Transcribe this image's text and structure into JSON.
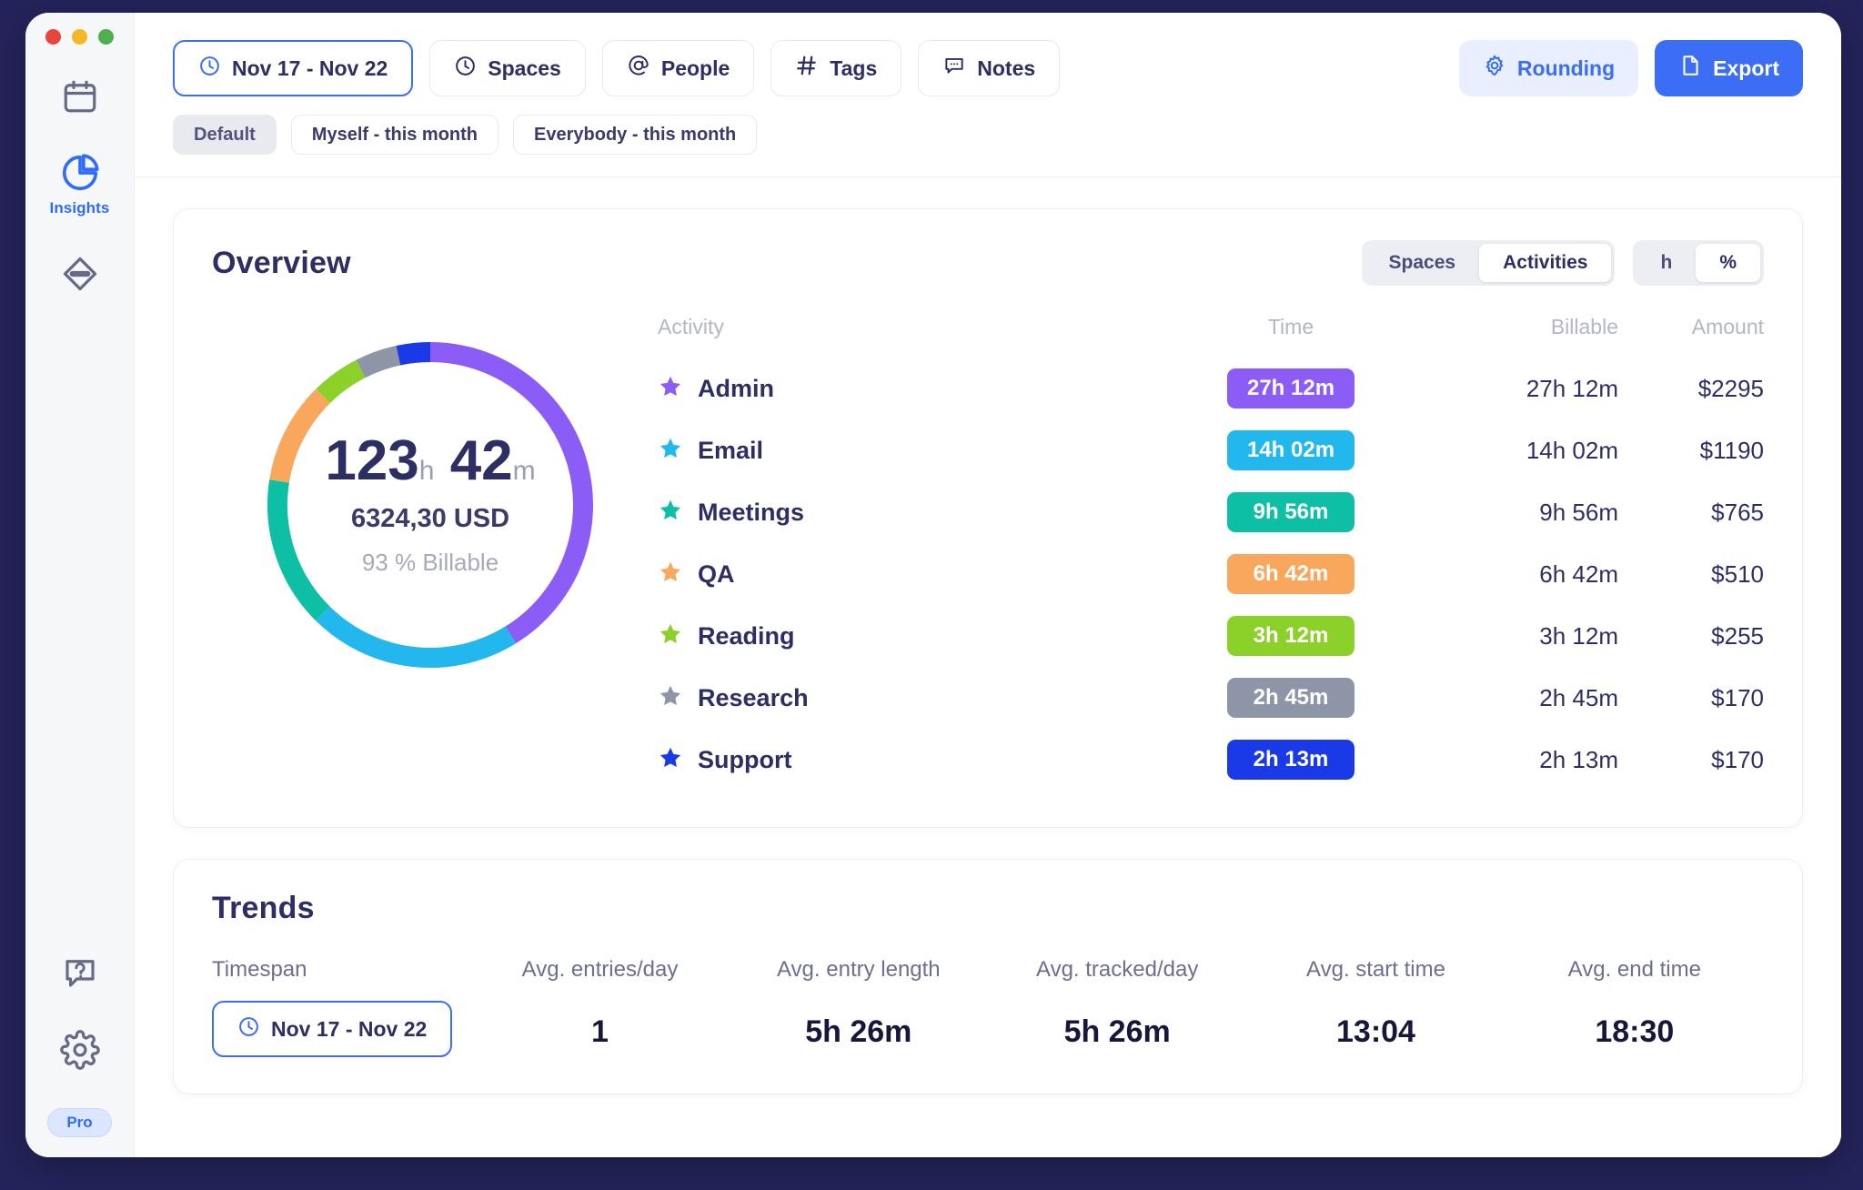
{
  "window": {
    "traffic_lights": [
      "close",
      "minimize",
      "maximize"
    ]
  },
  "sidebar": {
    "items": [
      {
        "icon": "calendar-icon",
        "label": ""
      },
      {
        "icon": "pie-chart-icon",
        "label": "Insights"
      },
      {
        "icon": "diamond-icon",
        "label": ""
      }
    ],
    "bottom_items": [
      {
        "icon": "help-icon",
        "label": ""
      },
      {
        "icon": "gear-icon",
        "label": ""
      }
    ],
    "pro_badge": "Pro",
    "active_color": "#2f6bff"
  },
  "toolbar": {
    "filters": [
      {
        "icon": "clock-icon",
        "label": "Nov 17 - Nov 22",
        "active": true
      },
      {
        "icon": "clock-icon",
        "label": "Spaces",
        "active": false
      },
      {
        "icon": "at-icon",
        "label": "People",
        "active": false
      },
      {
        "icon": "hash-icon",
        "label": "Tags",
        "active": false
      },
      {
        "icon": "comment-icon",
        "label": "Notes",
        "active": false
      }
    ],
    "rounding_label": "Rounding",
    "export_label": "Export",
    "accent": "#3b6df5"
  },
  "chips": [
    {
      "label": "Default",
      "selected": true
    },
    {
      "label": "Myself - this month",
      "selected": false
    },
    {
      "label": "Everybody - this month",
      "selected": false
    }
  ],
  "overview": {
    "title": "Overview",
    "toggle_group": [
      {
        "label": "Spaces",
        "on": false
      },
      {
        "label": "Activities",
        "on": true
      }
    ],
    "unit_group": [
      {
        "label": "h",
        "on": false
      },
      {
        "label": "%",
        "on": true
      }
    ],
    "center": {
      "hours": "123",
      "hours_unit": "h",
      "minutes": "42",
      "minutes_unit": "m",
      "amount": "6324,30 USD",
      "billable": "93 %  Billable"
    },
    "columns": [
      "Activity",
      "Time",
      "Billable",
      "Amount"
    ],
    "rows": [
      {
        "activity": "Admin",
        "time": "27h  12m",
        "billable": "27h  12m",
        "amount": "$2295",
        "color": "#8b5cf6"
      },
      {
        "activity": "Email",
        "time": "14h 02m",
        "billable": "14h 02m",
        "amount": "$1190",
        "color": "#22b8ed"
      },
      {
        "activity": "Meetings",
        "time": "9h 56m",
        "billable": "9h 56m",
        "amount": "$765",
        "color": "#0dc0a5"
      },
      {
        "activity": "QA",
        "time": "6h 42m",
        "billable": "6h 42m",
        "amount": "$510",
        "color": "#f9a75c"
      },
      {
        "activity": "Reading",
        "time": "3h  12m",
        "billable": "3h  12m",
        "amount": "$255",
        "color": "#8bd12a"
      },
      {
        "activity": "Research",
        "time": "2h 45m",
        "billable": "2h 45m",
        "amount": "$170",
        "color": "#8d95a6"
      },
      {
        "activity": "Support",
        "time": "2h  13m",
        "billable": "2h  13m",
        "amount": "$170",
        "color": "#1a3ae8"
      }
    ]
  },
  "chart_data": {
    "type": "pie",
    "title": "Overview",
    "subtitle": "123h 42m total",
    "labels": [
      "Admin",
      "Email",
      "Meetings",
      "QA",
      "Reading",
      "Research",
      "Support"
    ],
    "values_hours": [
      27.2,
      14.033,
      9.933,
      6.7,
      3.2,
      2.75,
      2.217
    ],
    "values_display": [
      "27h 12m",
      "14h 02m",
      "9h 56m",
      "6h 42m",
      "3h 12m",
      "2h 45m",
      "2h 13m"
    ],
    "amounts": [
      2295,
      1190,
      765,
      510,
      255,
      170,
      170
    ],
    "colors": [
      "#8b5cf6",
      "#22b8ed",
      "#0dc0a5",
      "#f9a75c",
      "#8bd12a",
      "#8d95a6",
      "#1a3ae8"
    ],
    "total_hours": 123.7,
    "total_display": "123h 42m",
    "total_amount": "6324,30 USD",
    "billable_pct": 93,
    "legend_position": "right",
    "donut": true
  },
  "trends": {
    "title": "Trends",
    "columns": [
      "Timespan",
      "Avg. entries/day",
      "Avg. entry length",
      "Avg. tracked/day",
      "Avg. start time",
      "Avg. end time"
    ],
    "timespan": "Nov 17 - Nov 22",
    "values": [
      "1",
      "5h 26m",
      "5h 26m",
      "13:04",
      "18:30"
    ]
  }
}
